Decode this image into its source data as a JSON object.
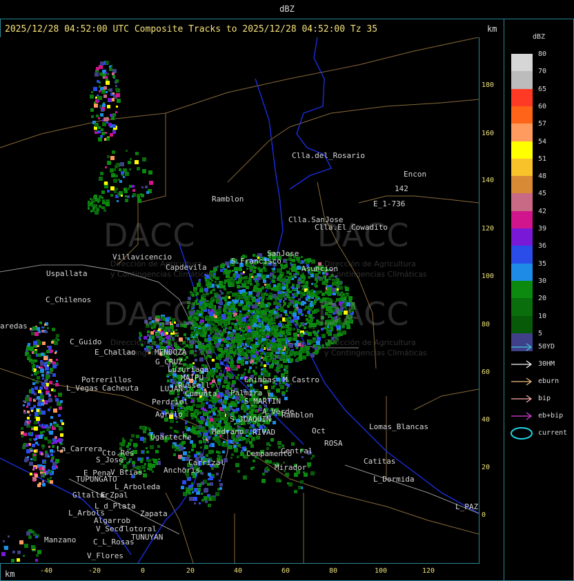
{
  "header": {
    "title": "dBZ",
    "subtitle": "2025/12/28 04:52:00 UTC Composite Tracks to 2025/12/28 04:52:00 Tz 35",
    "km_top": "km",
    "km_bottom": "km"
  },
  "axes": {
    "y_ticks": [
      "180",
      "160",
      "140",
      "120",
      "100",
      "80",
      "60",
      "40",
      "20",
      "0"
    ],
    "x_ticks": [
      "-40",
      "-20",
      "0",
      "20",
      "40",
      "60",
      "80",
      "100",
      "120"
    ]
  },
  "color_scale": {
    "title": "dBZ",
    "bins": [
      {
        "label": "80",
        "color": "#d6d6d6"
      },
      {
        "label": "70",
        "color": "#bcbcbc"
      },
      {
        "label": "65",
        "color": "#ff3a24"
      },
      {
        "label": "60",
        "color": "#ff6418"
      },
      {
        "label": "57",
        "color": "#ff9b5e"
      },
      {
        "label": "54",
        "color": "#ffff00"
      },
      {
        "label": "51",
        "color": "#f7c22a"
      },
      {
        "label": "48",
        "color": "#d88a34"
      },
      {
        "label": "45",
        "color": "#c86a86"
      },
      {
        "label": "42",
        "color": "#d1158c"
      },
      {
        "label": "39",
        "color": "#7a18d8"
      },
      {
        "label": "36",
        "color": "#2a4ce8"
      },
      {
        "label": "35",
        "color": "#1e8ce6"
      },
      {
        "label": "30",
        "color": "#0c8a10"
      },
      {
        "label": "20",
        "color": "#0a6e0c"
      },
      {
        "label": "10",
        "color": "#075a08"
      },
      {
        "label": "5",
        "color": "#40408a"
      }
    ]
  },
  "track_legend": [
    {
      "label": "50YD",
      "color": "#3ec8d8",
      "type": "arrow"
    },
    {
      "label": "30HM",
      "color": "#ffffff",
      "type": "arrow"
    },
    {
      "label": "eburn",
      "color": "#f0c080",
      "type": "arrow"
    },
    {
      "label": "bip",
      "color": "#ffb0b0",
      "type": "arrow"
    },
    {
      "label": "eb+bip",
      "color": "#e040e0",
      "type": "arrow"
    },
    {
      "label": "current",
      "color": "#20d8e8",
      "type": "ellipse"
    }
  ],
  "watermark": {
    "brand": "DACC",
    "line1": "Dirección de Agricultura",
    "line2": "y Contingencias Climáticas"
  },
  "places": [
    {
      "name": "Clla.del_Rosario",
      "x": 423,
      "y": 165
    },
    {
      "name": "Encon",
      "x": 585,
      "y": 192
    },
    {
      "name": "142",
      "x": 572,
      "y": 213
    },
    {
      "name": "E_1-736",
      "x": 541,
      "y": 235
    },
    {
      "name": "Ramblon",
      "x": 307,
      "y": 228
    },
    {
      "name": "Clla.SanJose",
      "x": 418,
      "y": 258
    },
    {
      "name": "Clla.El_Cowadito",
      "x": 456,
      "y": 269
    },
    {
      "name": "Villavicencio",
      "x": 163,
      "y": 312
    },
    {
      "name": "Capdevila",
      "x": 240,
      "y": 327
    },
    {
      "name": "S.Francisco",
      "x": 335,
      "y": 318
    },
    {
      "name": "SanJose",
      "x": 387,
      "y": 307
    },
    {
      "name": "Asuncion",
      "x": 437,
      "y": 329
    },
    {
      "name": "Uspallata",
      "x": 67,
      "y": 336
    },
    {
      "name": "C_Chilenos",
      "x": 66,
      "y": 374
    },
    {
      "name": "aredas",
      "x": 0,
      "y": 412
    },
    {
      "name": "C_Guido",
      "x": 101,
      "y": 435
    },
    {
      "name": "E_Challao",
      "x": 137,
      "y": 450
    },
    {
      "name": "MENDOZA",
      "x": 224,
      "y": 450
    },
    {
      "name": "G_CRUZ",
      "x": 225,
      "y": 464
    },
    {
      "name": "Luzuriaga",
      "x": 243,
      "y": 475
    },
    {
      "name": "Potrerillos",
      "x": 118,
      "y": 490
    },
    {
      "name": "L_Vegas",
      "x": 96,
      "y": 502
    },
    {
      "name": "Cacheuta",
      "x": 148,
      "y": 502
    },
    {
      "name": "MAIPU",
      "x": 262,
      "y": 487
    },
    {
      "name": "Russell",
      "x": 258,
      "y": 498
    },
    {
      "name": "Cumunta",
      "x": 268,
      "y": 510
    },
    {
      "name": "LUJAN",
      "x": 232,
      "y": 503
    },
    {
      "name": "Perdriel",
      "x": 220,
      "y": 522
    },
    {
      "name": "S_MARTIN",
      "x": 354,
      "y": 521
    },
    {
      "name": "Palmira",
      "x": 334,
      "y": 509
    },
    {
      "name": "Chimbas",
      "x": 354,
      "y": 490
    },
    {
      "name": "M_Castro",
      "x": 410,
      "y": 490
    },
    {
      "name": "Agrelo",
      "x": 225,
      "y": 540
    },
    {
      "name": "A_Verde",
      "x": 380,
      "y": 536
    },
    {
      "name": "Ramblon",
      "x": 408,
      "y": 541
    },
    {
      "name": "S_JOAQUIN",
      "x": 333,
      "y": 547
    },
    {
      "name": "Ugarteche",
      "x": 218,
      "y": 573
    },
    {
      "name": "Medrano",
      "x": 307,
      "y": 565
    },
    {
      "name": "RIVAD",
      "x": 366,
      "y": 566
    },
    {
      "name": "Oct",
      "x": 452,
      "y": 564
    },
    {
      "name": "Lomas_Blancas",
      "x": 535,
      "y": 558
    },
    {
      "name": "ROSA",
      "x": 470,
      "y": 582
    },
    {
      "name": "Catitas",
      "x": 527,
      "y": 608
    },
    {
      "name": "La_Carrera",
      "x": 82,
      "y": 590
    },
    {
      "name": "Cto.Res",
      "x": 148,
      "y": 596
    },
    {
      "name": "S_Jose",
      "x": 139,
      "y": 606
    },
    {
      "name": "Cempamento",
      "x": 357,
      "y": 597
    },
    {
      "name": "Central",
      "x": 407,
      "y": 593
    },
    {
      "name": "Carrizal",
      "x": 273,
      "y": 610
    },
    {
      "name": "Anchoris",
      "x": 237,
      "y": 621
    },
    {
      "name": "E_Pena",
      "x": 121,
      "y": 625
    },
    {
      "name": "V_Btias",
      "x": 160,
      "y": 624
    },
    {
      "name": "TUPUNGATO",
      "x": 110,
      "y": 634
    },
    {
      "name": "Mirador",
      "x": 398,
      "y": 617
    },
    {
      "name": "L_Dormida",
      "x": 541,
      "y": 634
    },
    {
      "name": "L_Arboleda",
      "x": 166,
      "y": 645
    },
    {
      "name": "Gltallar",
      "x": 105,
      "y": 657
    },
    {
      "name": "E_Zpal",
      "x": 146,
      "y": 657
    },
    {
      "name": "L_d_Plata",
      "x": 137,
      "y": 673
    },
    {
      "name": "L_Arbols",
      "x": 99,
      "y": 683
    },
    {
      "name": "Zapata",
      "x": 203,
      "y": 684
    },
    {
      "name": "L_PAZ",
      "x": 660,
      "y": 674
    },
    {
      "name": "Algarrob",
      "x": 136,
      "y": 694
    },
    {
      "name": "V_Seco",
      "x": 139,
      "y": 706
    },
    {
      "name": "Tlotoral",
      "x": 174,
      "y": 706
    },
    {
      "name": "TUNUYAN",
      "x": 190,
      "y": 718
    },
    {
      "name": "Manzano",
      "x": 64,
      "y": 722
    },
    {
      "name": "C_L_Rosas",
      "x": 135,
      "y": 725
    },
    {
      "name": "V_Flores",
      "x": 126,
      "y": 745
    }
  ]
}
